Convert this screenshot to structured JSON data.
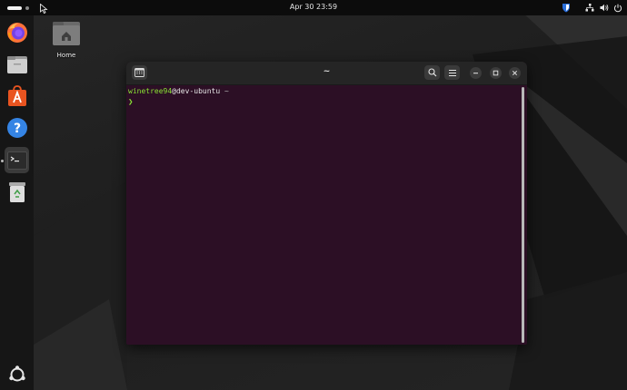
{
  "topbar": {
    "clock": "Apr 30  23:59",
    "tray": [
      "bitwarden-icon",
      "network-icon",
      "volume-icon",
      "power-icon"
    ]
  },
  "dock": {
    "items": [
      {
        "name": "Firefox",
        "icon": "firefox-icon"
      },
      {
        "name": "Files",
        "icon": "files-icon"
      },
      {
        "name": "App Center",
        "icon": "app-center-icon"
      },
      {
        "name": "Help",
        "icon": "help-icon"
      },
      {
        "name": "Terminal",
        "icon": "terminal-icon",
        "active": true
      },
      {
        "name": "Trash",
        "icon": "trash-icon"
      }
    ],
    "apps_grid_icon": "ubuntu-icon"
  },
  "desktop": {
    "home_label": "Home"
  },
  "terminal": {
    "title": "~",
    "prompt_user": "winetree94",
    "prompt_host": "@dev-ubuntu",
    "prompt_path": " ~",
    "prompt_symbol": "❯"
  },
  "colors": {
    "terminal_bg": "#2c0f25",
    "prompt_green": "#8ae234",
    "headerbar": "#252525",
    "accent_orange": "#e95420"
  }
}
